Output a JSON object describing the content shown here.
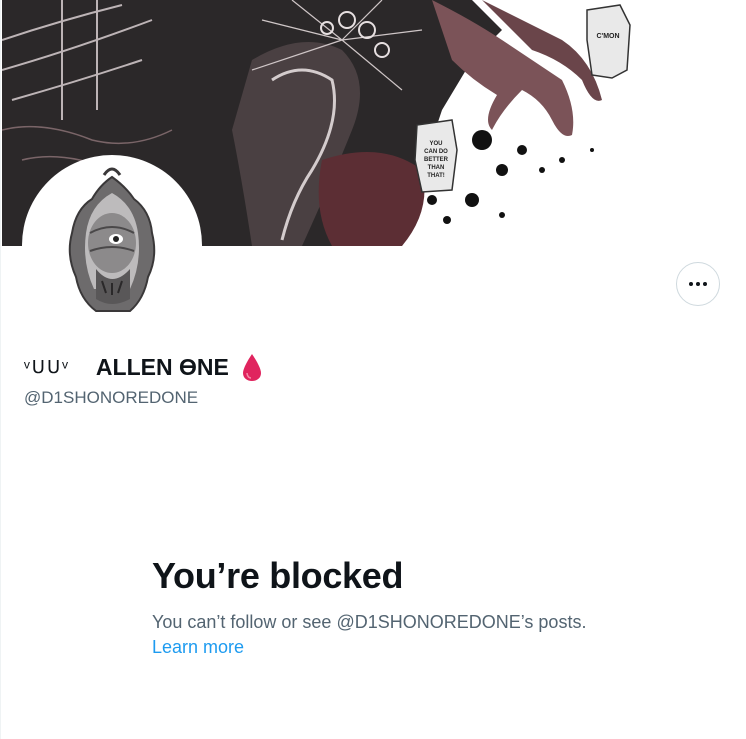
{
  "profile": {
    "name_decoration": "ᵛᑌᑌᵛ",
    "display_name": "ALLEN ϴNE",
    "handle": "@D1SHONOREDONE"
  },
  "banner": {
    "bubble_cmon": "C'MON",
    "bubble_better": [
      "YOU",
      "CAN DO",
      "BETTER",
      "THAN",
      "THAT!"
    ]
  },
  "blocked": {
    "title": "You’re blocked",
    "description": "You can’t follow or see @D1SHONOREDONE’s posts.",
    "learn_more": "Learn more"
  },
  "colors": {
    "text_primary": "#0f1419",
    "text_secondary": "#536471",
    "link": "#1d9bf0",
    "drop": "#e0245e"
  },
  "icons": {
    "more": "ellipsis-icon",
    "drop": "blood-drop-icon"
  }
}
